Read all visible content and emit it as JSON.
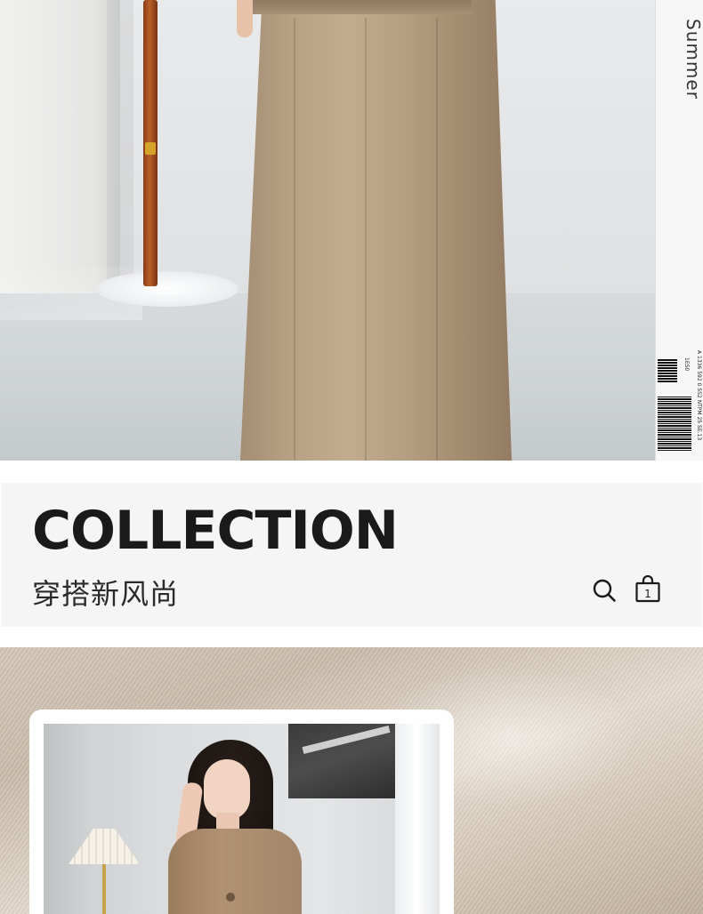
{
  "top_photo": {
    "tag_text": "Summer",
    "tag_code_line1": "A 1336 592 0 5S2 NTPM 25 SE.13",
    "tag_code_line2": "1ES0"
  },
  "collection_banner": {
    "title": "COLLECTION",
    "subtitle": "穿搭新风尚",
    "icons": [
      "search-icon",
      "shopping-bag-icon"
    ],
    "bag_count": "1"
  },
  "colors": {
    "banner_background": "#f5f5f5",
    "title_text": "#1a1a1a",
    "skirt_khaki": "#b7a184",
    "fabric_beige": "#d8cdbf"
  }
}
